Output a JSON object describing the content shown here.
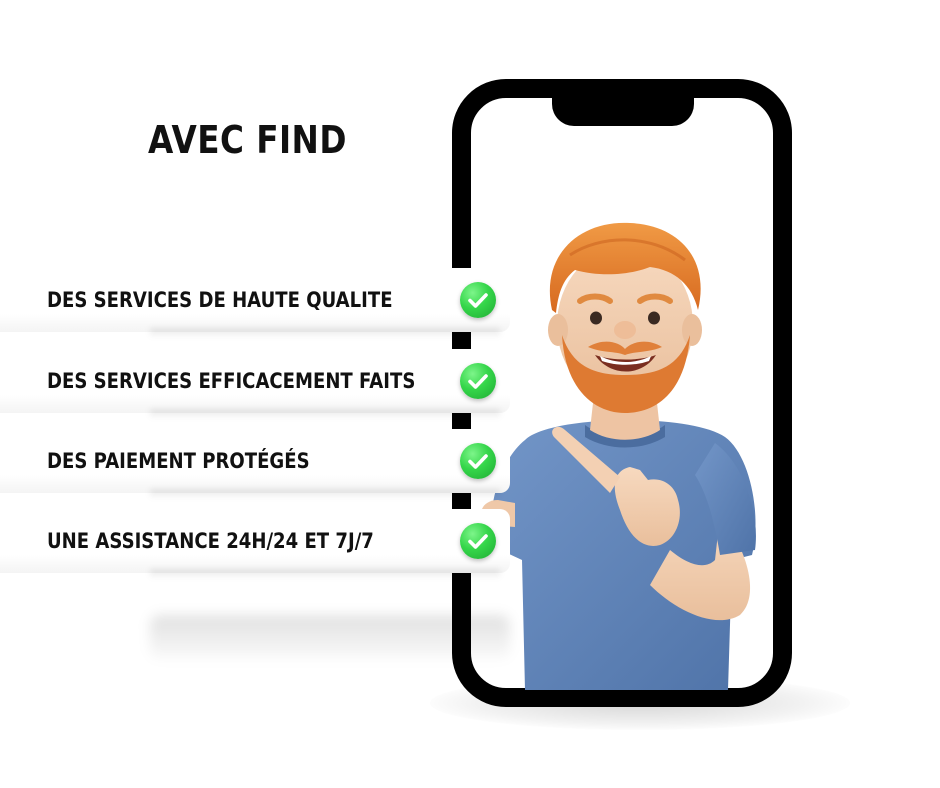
{
  "heading": "AVEC FIND",
  "features": [
    {
      "label": "DES SERVICES DE HAUTE QUALITE",
      "icon": "check-circle-icon"
    },
    {
      "label": "DES SERVICES EFFICACEMENT FAITS",
      "icon": "check-circle-icon"
    },
    {
      "label": "DES PAIEMENT PROTÉGÉS",
      "icon": "check-circle-icon"
    },
    {
      "label": "UNE ASSISTANCE 24H/24 ET 7J/7",
      "icon": "check-circle-icon"
    }
  ],
  "colors": {
    "check": "#2ecc40",
    "shirt": "#5f84b8",
    "hair": "#e07a2c",
    "phone_frame": "#000000"
  }
}
